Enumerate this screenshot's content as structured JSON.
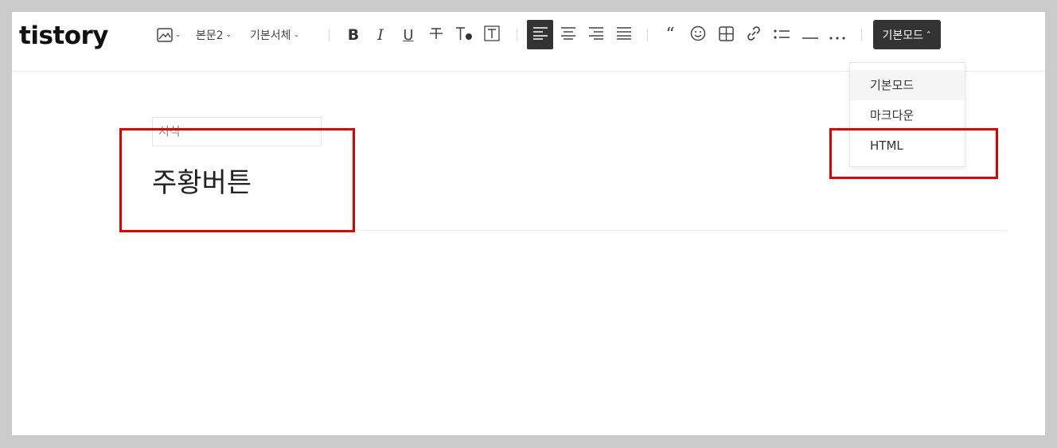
{
  "app": {
    "logo": "tistory"
  },
  "toolbar": {
    "image_icon": "image-icon",
    "paragraph_style": "본문2",
    "font_family": "기본서체",
    "bold_icon": "bold-icon",
    "italic_icon": "italic-icon",
    "underline_icon": "underline-icon",
    "strikethrough_icon": "strikethrough-icon",
    "text_color_icon": "text-color-icon",
    "text_background_icon": "text-background-icon",
    "align_left_icon": "align-left-icon",
    "align_center_icon": "align-center-icon",
    "align_right_icon": "align-right-icon",
    "align_justify_icon": "align-justify-icon",
    "quote_icon": "quote-icon",
    "emoji_icon": "emoji-icon",
    "table_icon": "table-icon",
    "link_icon": "link-icon",
    "list_icon": "list-icon",
    "horizontal_line_icon": "horizontal-line-icon",
    "more_icon": "more-icon",
    "mode_button_label": "기본모드"
  },
  "mode_dropdown": {
    "items": [
      {
        "label": "기본모드",
        "selected": true
      },
      {
        "label": "마크다운",
        "selected": false
      },
      {
        "label": "HTML",
        "selected": false
      }
    ]
  },
  "editor": {
    "category": "서식",
    "title": "주황버튼"
  },
  "colors": {
    "accent_dark": "#333333",
    "highlight_box": "#e00000"
  }
}
